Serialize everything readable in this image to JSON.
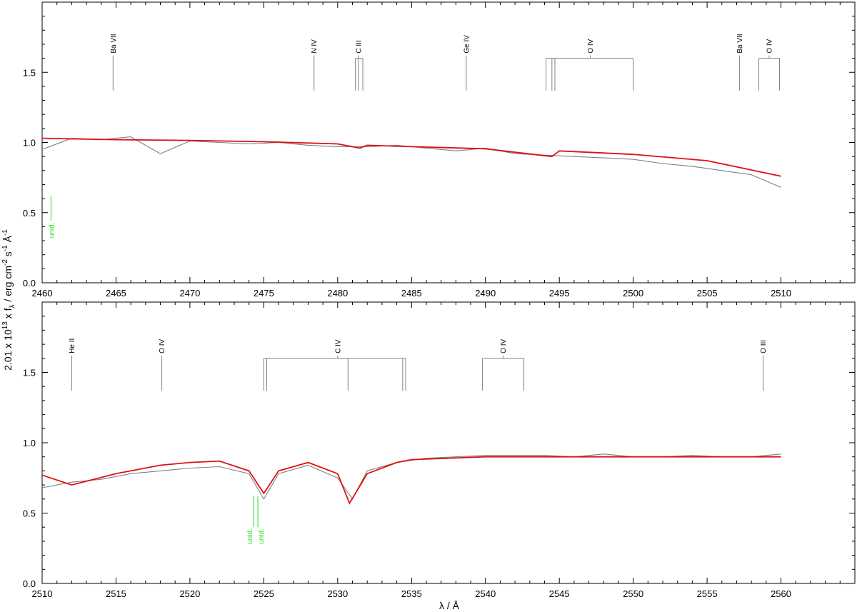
{
  "chart_data": [
    {
      "type": "line",
      "panel": "top",
      "xlim": [
        2460,
        2515
      ],
      "ylim": [
        0.0,
        2.0
      ],
      "xticks": [
        2460,
        2465,
        2470,
        2475,
        2480,
        2485,
        2490,
        2495,
        2500,
        2505,
        2510
      ],
      "yticks": [
        0.0,
        0.5,
        1.0,
        1.5
      ],
      "ytick_labels": [
        "0.0",
        "0.5",
        "1.0",
        "1.5"
      ],
      "grid": false,
      "series": [
        {
          "color": "#808080",
          "x": [
            2460,
            2462,
            2464,
            2466,
            2468,
            2470,
            2472,
            2474,
            2476,
            2478,
            2480,
            2482,
            2484,
            2486,
            2488,
            2490,
            2492,
            2494,
            2496,
            2498,
            2500,
            2502,
            2504,
            2506,
            2508,
            2510
          ],
          "values": [
            0.95,
            1.03,
            1.02,
            1.04,
            0.92,
            1.01,
            1.0,
            0.99,
            1.0,
            0.98,
            0.97,
            0.97,
            0.98,
            0.96,
            0.94,
            0.96,
            0.92,
            0.91,
            0.9,
            0.89,
            0.88,
            0.85,
            0.83,
            0.8,
            0.77,
            0.68
          ]
        },
        {
          "color": "#dd1111",
          "x": [
            2460,
            2465,
            2470,
            2475,
            2480,
            2481.5,
            2482,
            2485,
            2490,
            2494.5,
            2495,
            2500,
            2505,
            2510
          ],
          "values": [
            1.03,
            1.02,
            1.015,
            1.005,
            0.99,
            0.96,
            0.98,
            0.97,
            0.955,
            0.9,
            0.94,
            0.915,
            0.87,
            0.76
          ]
        }
      ],
      "line_ids": [
        {
          "label": "Ba VII",
          "positions": [
            2464.8
          ],
          "bracket_x": 2464.8
        },
        {
          "label": "N IV",
          "positions": [
            2478.4
          ],
          "bracket_x": 2478.4
        },
        {
          "label": "C III",
          "positions": [
            2481.2,
            2481.4,
            2481.7
          ],
          "bracket_x": 2481.4
        },
        {
          "label": "Ge IV",
          "positions": [
            2488.7
          ],
          "bracket_x": 2488.7
        },
        {
          "label": "O IV",
          "positions": [
            2494.1,
            2494.5,
            2494.7,
            2500.0
          ],
          "bracket_x": 2497.1
        },
        {
          "label": "Ba VII",
          "positions": [
            2507.2
          ],
          "bracket_x": 2507.2
        },
        {
          "label": "O IV",
          "positions": [
            2508.5,
            2509.9
          ],
          "bracket_x": 2509.2
        }
      ],
      "unid": [
        {
          "label": "unid.",
          "position": 2460.6
        }
      ]
    },
    {
      "type": "line",
      "panel": "bottom",
      "xlim": [
        2510,
        2565
      ],
      "ylim": [
        0.0,
        2.0
      ],
      "xticks": [
        2510,
        2515,
        2520,
        2525,
        2530,
        2535,
        2540,
        2545,
        2550,
        2555,
        2560
      ],
      "yticks": [
        0.0,
        0.5,
        1.0,
        1.5
      ],
      "ytick_labels": [
        "0.0",
        "0.5",
        "1.0",
        "1.5"
      ],
      "grid": false,
      "series": [
        {
          "color": "#808080",
          "x": [
            2510,
            2512,
            2514,
            2516,
            2518,
            2520,
            2522,
            2524,
            2525,
            2526,
            2528,
            2530,
            2531,
            2532,
            2534,
            2536,
            2538,
            2540,
            2542,
            2544,
            2546,
            2548,
            2550,
            2552,
            2554,
            2556,
            2558,
            2560
          ],
          "values": [
            0.68,
            0.72,
            0.74,
            0.78,
            0.8,
            0.82,
            0.83,
            0.78,
            0.6,
            0.78,
            0.84,
            0.75,
            0.6,
            0.8,
            0.86,
            0.89,
            0.9,
            0.91,
            0.91,
            0.91,
            0.9,
            0.92,
            0.9,
            0.9,
            0.91,
            0.9,
            0.9,
            0.92
          ]
        },
        {
          "color": "#dd1111",
          "x": [
            2510,
            2512,
            2515,
            2518,
            2520,
            2522,
            2524,
            2525,
            2526,
            2528,
            2530,
            2530.8,
            2532,
            2534,
            2535,
            2540,
            2545,
            2550,
            2555,
            2560
          ],
          "values": [
            0.77,
            0.7,
            0.78,
            0.84,
            0.86,
            0.87,
            0.8,
            0.64,
            0.8,
            0.86,
            0.78,
            0.57,
            0.78,
            0.86,
            0.88,
            0.9,
            0.9,
            0.9,
            0.9,
            0.9
          ]
        }
      ],
      "line_ids": [
        {
          "label": "He II",
          "positions": [
            2512.0
          ],
          "bracket_x": 2512.0
        },
        {
          "label": "O IV",
          "positions": [
            2518.1
          ],
          "bracket_x": 2518.1
        },
        {
          "label": "C IV",
          "positions": [
            2525.0,
            2525.2,
            2530.7,
            2534.4,
            2534.6
          ],
          "bracket_x": 2530.0
        },
        {
          "label": "O IV",
          "positions": [
            2539.8,
            2542.6
          ],
          "bracket_x": 2541.2
        },
        {
          "label": "O III",
          "positions": [
            2558.8
          ],
          "bracket_x": 2558.8
        }
      ],
      "unid": [
        {
          "label": "unid.",
          "position": 2524.3
        },
        {
          "label": "unid.",
          "position": 2524.6
        }
      ]
    }
  ],
  "axes": {
    "ylabel": "2.01 x 10",
    "ylabel_exp": "13",
    "ylabel_mid": "x f",
    "ylabel_sub": "λ",
    "ylabel_units": "/ erg cm",
    "ylabel_units_exp1": "-2",
    "ylabel_units_s": "s",
    "ylabel_units_exp2": "-1",
    "ylabel_units_a": "Å",
    "ylabel_units_exp3": "-1",
    "xlabel": "λ / Å"
  },
  "colors": {
    "observation": "#808080",
    "model": "#dd1111",
    "unid": "#22dd22",
    "ids": "#808080"
  }
}
